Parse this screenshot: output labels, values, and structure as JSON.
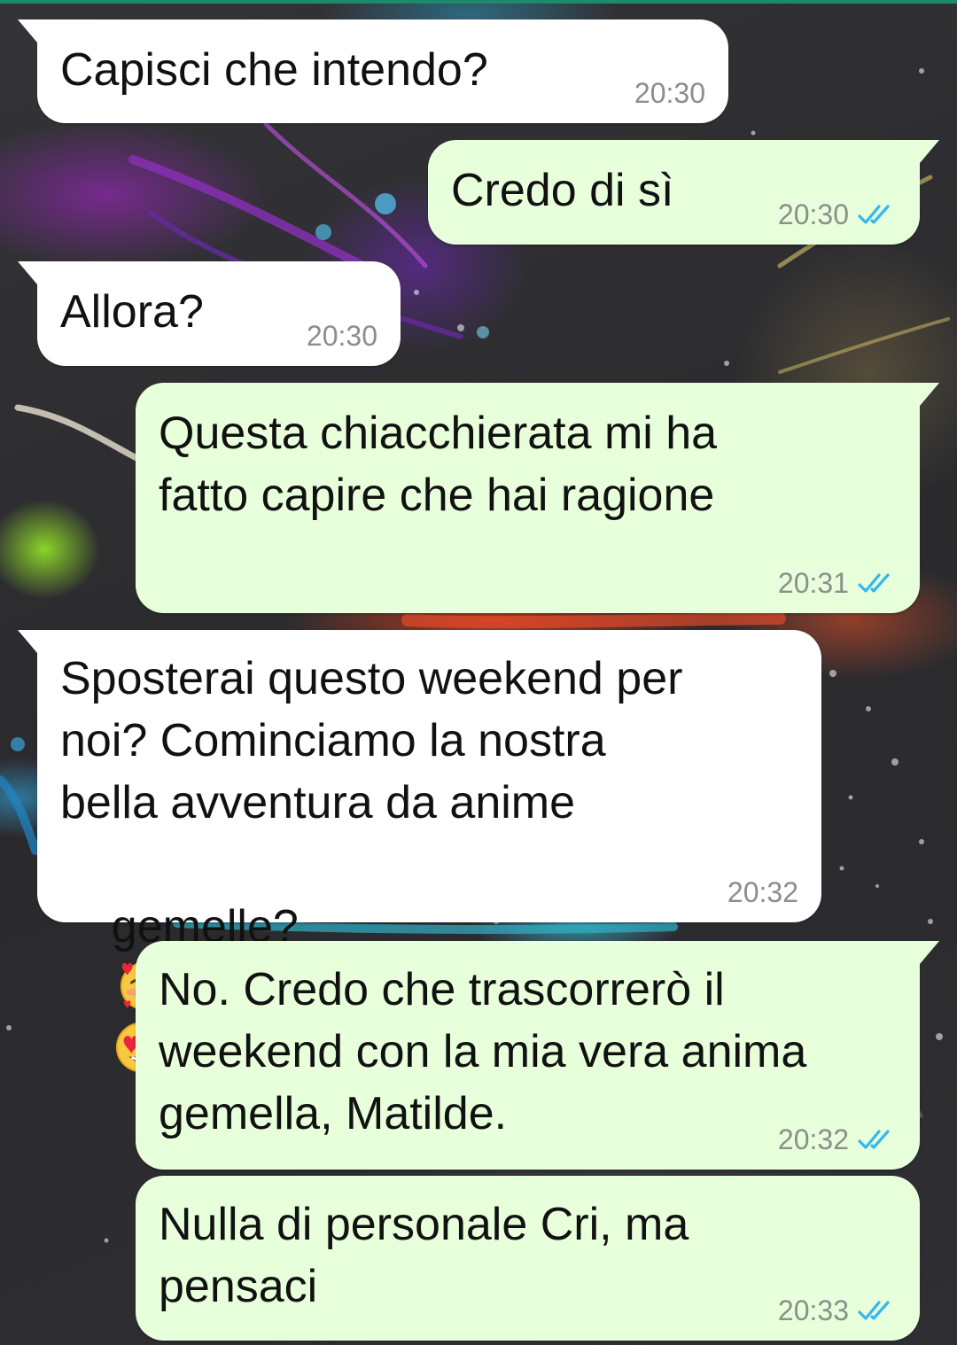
{
  "colors": {
    "incoming_bubble": "#ffffff",
    "outgoing_bubble": "#e7ffdb",
    "timestamp": "#8a8f8a",
    "read_ticks": "#34b7f1"
  },
  "messages": [
    {
      "direction": "incoming",
      "text": "Capisci che intendo?",
      "time": "20:30"
    },
    {
      "direction": "outgoing",
      "text": "Credo di sì",
      "time": "20:30",
      "status": "read-double-check-icon"
    },
    {
      "direction": "incoming",
      "text": "Allora?",
      "time": "20:30"
    },
    {
      "direction": "outgoing",
      "lines": [
        "Questa chiacchierata mi ha",
        "fatto capire che hai ragione"
      ],
      "time": "20:31",
      "status": "read-double-check-icon"
    },
    {
      "direction": "incoming",
      "lines": [
        "Sposterai questo weekend per",
        "noi? Cominciamo la nostra",
        "bella avventura da anime",
        "gemelle?"
      ],
      "emojis": [
        "smiling-face-with-hearts-emoji",
        "heart-eyes-emoji"
      ],
      "time": "20:32"
    },
    {
      "direction": "outgoing",
      "lines": [
        "No. Credo che trascorrerò il",
        "weekend con la mia vera anima",
        "gemella, Matilde."
      ],
      "time": "20:32",
      "status": "read-double-check-icon"
    },
    {
      "direction": "outgoing",
      "lines": [
        "Nulla di personale Cri, ma",
        "pensaci"
      ],
      "time": "20:33",
      "status": "read-double-check-icon"
    }
  ]
}
